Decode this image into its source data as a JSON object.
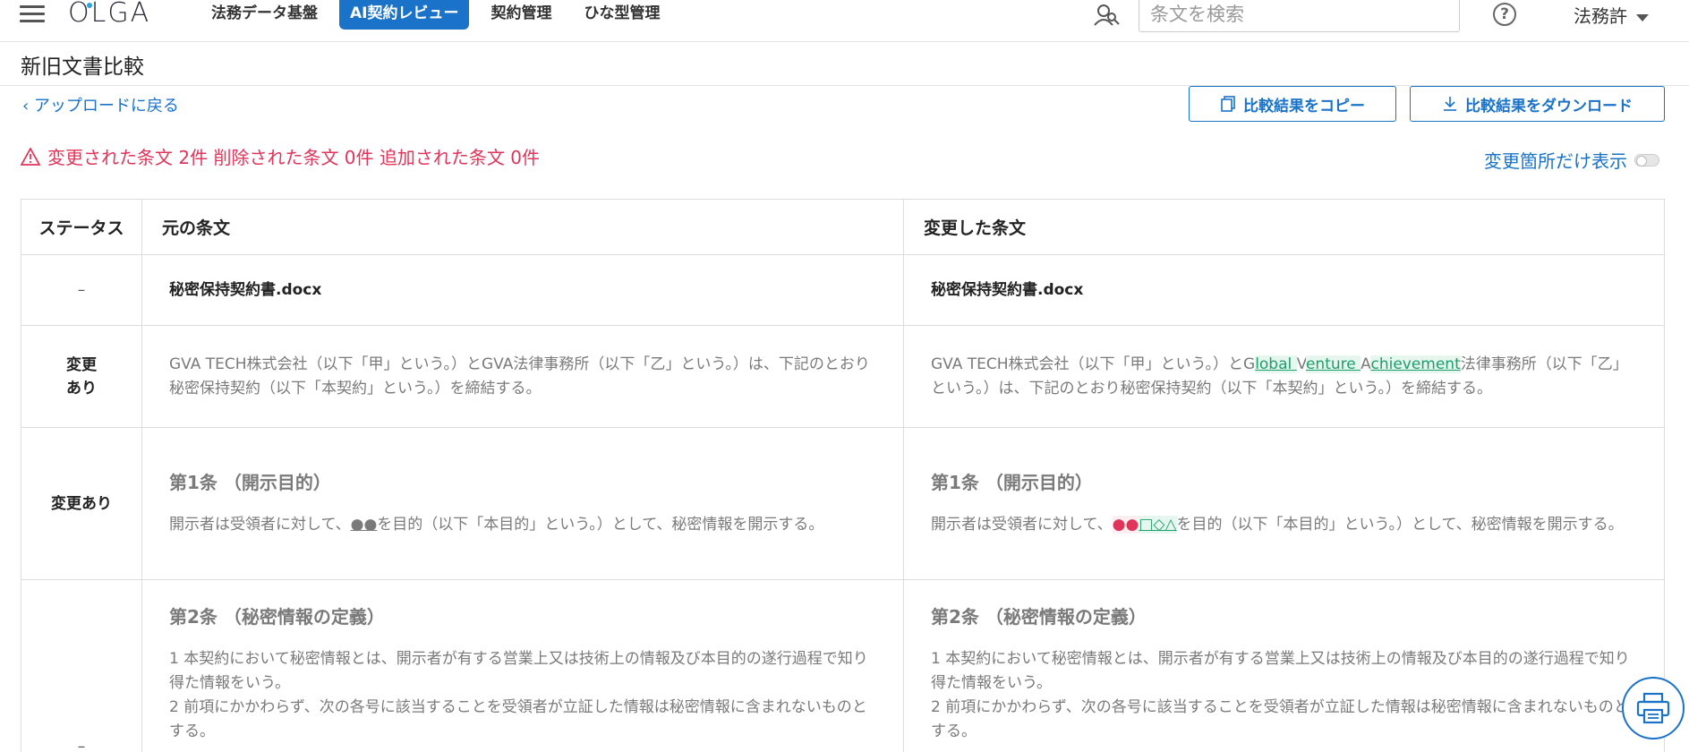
{
  "app": {
    "logo": "OLGA",
    "nav": [
      "法務データ基盤",
      "AI契約レビュー",
      "契約管理",
      "ひな型管理"
    ],
    "search_placeholder": "条文を検索",
    "user": "法務許",
    "help": "?"
  },
  "page": {
    "title": "新旧文書比較",
    "back_link": "アップロードに戻る",
    "copy_button": "比較結果をコピー",
    "download_button": "比較結果をダウンロード",
    "summary": "変更された条文 2件 削除された条文 0件 追加された条文 0件",
    "toggle_label": "変更箇所だけ表示"
  },
  "table": {
    "headers": [
      "ステータス",
      "元の条文",
      "変更した条文"
    ],
    "rows": [
      {
        "status": "–",
        "old": "秘密保持契約書.docx",
        "new": "秘密保持契約書.docx"
      },
      {
        "status_line1": "変更",
        "status_line2": "あり",
        "old": "GVA TECH株式会社（以下「甲」という。）とGVA法律事務所（以下「乙」という。）は、下記のとおり秘密保持契約（以下「本契約」という。）を締結する。",
        "new_before": "GVA TECH株式会社（以下「甲」という。）とG",
        "new_add1": "lobal ",
        "new_mid1": "V",
        "new_add2": "enture ",
        "new_mid2": "A",
        "new_add3": "chievement",
        "new_after": "法律事務所（以下「乙」という。）は、下記のとおり秘密保持契約（以下「本契約」という。）を締結する。"
      },
      {
        "status": "変更あり",
        "article": "第1条 （開示目的）",
        "old_before": "開示者は受領者に対して、",
        "old_mark": "●●",
        "old_after": "を目的（以下「本目的」という。）として、秘密情報を開示する。",
        "new_before": "開示者は受領者に対して、",
        "new_del": "●●",
        "new_add": "□◇△",
        "new_after": "を目的（以下「本目的」という。）として、秘密情報を開示する。"
      },
      {
        "status": "–",
        "article": "第2条 （秘密情報の定義）",
        "para1": "1 本契約において秘密情報とは、開示者が有する営業上又は技術上の情報及び本目的の遂行過程で知り得た情報をいう。",
        "para2": "2 前項にかかわらず、次の各号に該当することを受領者が立証した情報は秘密情報に含まれないものとする。"
      }
    ]
  },
  "colors": {
    "primary": "#1a72c9",
    "alert": "#e0355a",
    "added": "#1e9e6a"
  }
}
